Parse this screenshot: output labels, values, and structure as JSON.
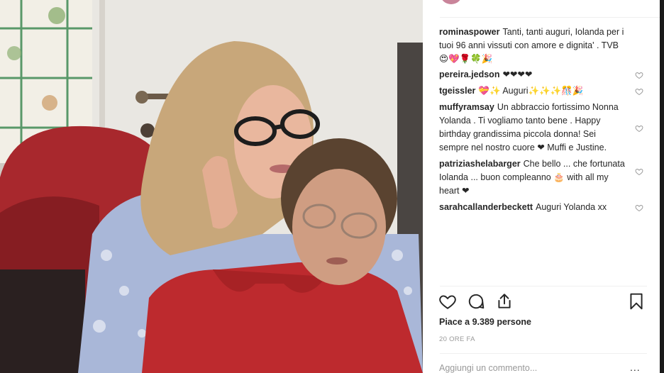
{
  "post": {
    "caption": {
      "user": "rominaspower",
      "text": "Tanti, tanti auguri, Iolanda per i tuoi 96 anni vissuti con amore e dignita' . TVB 😍💖🌹🍀🎉"
    },
    "comments": [
      {
        "user": "pereira.jedson",
        "text": "❤❤❤❤"
      },
      {
        "user": "tgeissler",
        "text": "💝✨ Auguri✨✨✨🎊🎉"
      },
      {
        "user": "muffyramsay",
        "text": "Un abbraccio fortissimo Nonna Yolanda . Ti vogliamo tanto bene . Happy birthday grandissima piccola donna! Sei sempre nel nostro cuore ❤ Muffi e Justine."
      },
      {
        "user": "patriziashelabarger",
        "text": "Che bello ... che fortunata Iolanda ... buon compleanno 🎂 with all my heart ❤"
      },
      {
        "user": "sarahcallanderbeckett",
        "text": "Auguri Yolanda xx"
      }
    ],
    "likes_text": "Piace a 9.389 persone",
    "time_text": "20 ORE FA",
    "add_comment_placeholder": "Aggiungi un commento...",
    "more_options": "...",
    "icons": {
      "like": "heart-icon",
      "comment": "comment-icon",
      "share": "share-icon",
      "save": "bookmark-icon",
      "comment_like": "heart-outline-icon"
    },
    "colors": {
      "text": "#262626",
      "muted": "#999999",
      "divider": "#efefef"
    }
  }
}
